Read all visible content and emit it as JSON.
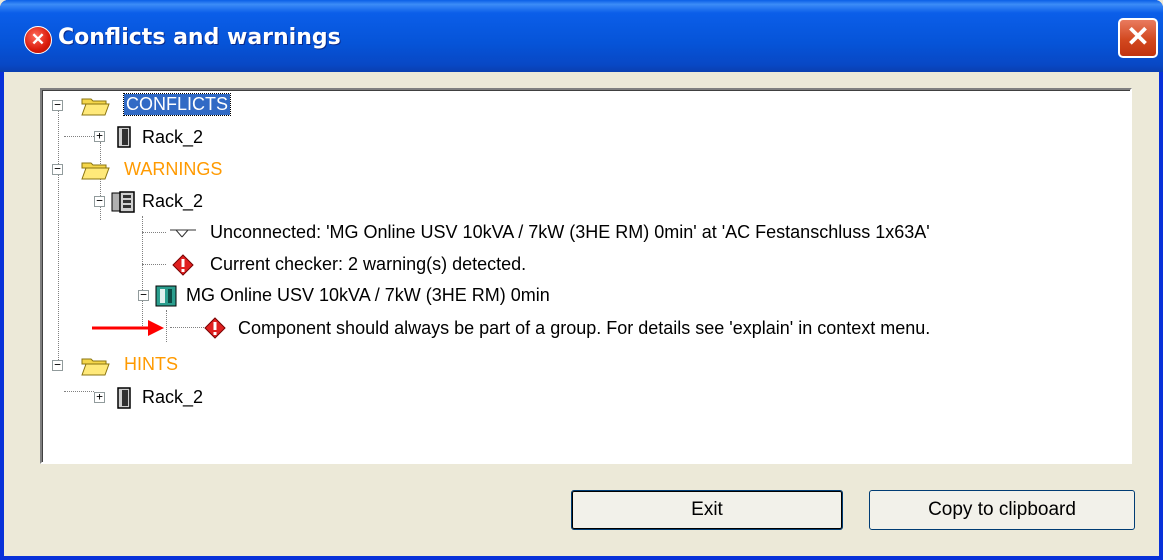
{
  "window": {
    "title": "Conflicts and warnings",
    "close_glyph": "✕"
  },
  "tree": {
    "conflicts": {
      "label": "CONFLICTS",
      "rack": "Rack_2"
    },
    "warnings": {
      "label": "WARNINGS",
      "rack": "Rack_2",
      "children": [
        "Unconnected: 'MG Online USV 10kVA / 7kW (3HE RM) 0min' at 'AC Festanschluss 1x63A'",
        "Current checker: 2 warning(s) detected.",
        "MG Online USV 10kVA / 7kW (3HE RM) 0min"
      ],
      "component_message": "Component should always be part of a group. For details see 'explain' in context menu."
    },
    "hints": {
      "label": "HINTS",
      "rack": "Rack_2"
    }
  },
  "buttons": {
    "exit": "Exit",
    "copy": "Copy to clipboard"
  },
  "colors": {
    "category_label": "#ff9a00",
    "selection": "#316ac5",
    "warning_icon": "#e02020",
    "annotation_arrow": "#ff0000"
  }
}
